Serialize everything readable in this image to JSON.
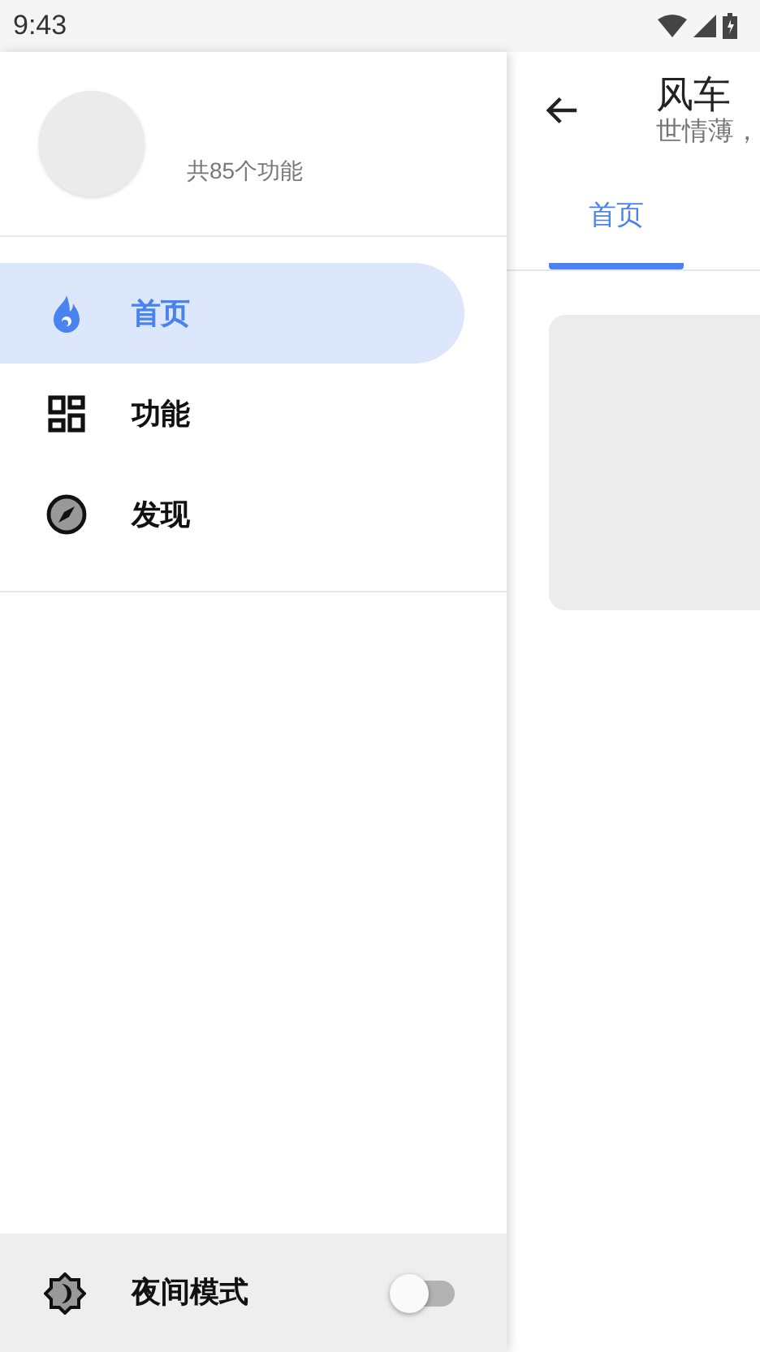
{
  "status_bar": {
    "time": "9:43"
  },
  "drawer": {
    "subtitle": "共85个功能",
    "items": [
      {
        "kind": "flame",
        "label": "首页",
        "selected": true
      },
      {
        "kind": "grid",
        "label": "功能",
        "selected": false
      },
      {
        "kind": "compass",
        "label": "发现",
        "selected": false
      }
    ],
    "night_mode": {
      "label": "夜间模式",
      "on": false
    }
  },
  "app_bar": {
    "title": "风车",
    "subtitle": "世情薄，"
  },
  "tabs": [
    {
      "label": "首页",
      "selected": true
    }
  ]
}
